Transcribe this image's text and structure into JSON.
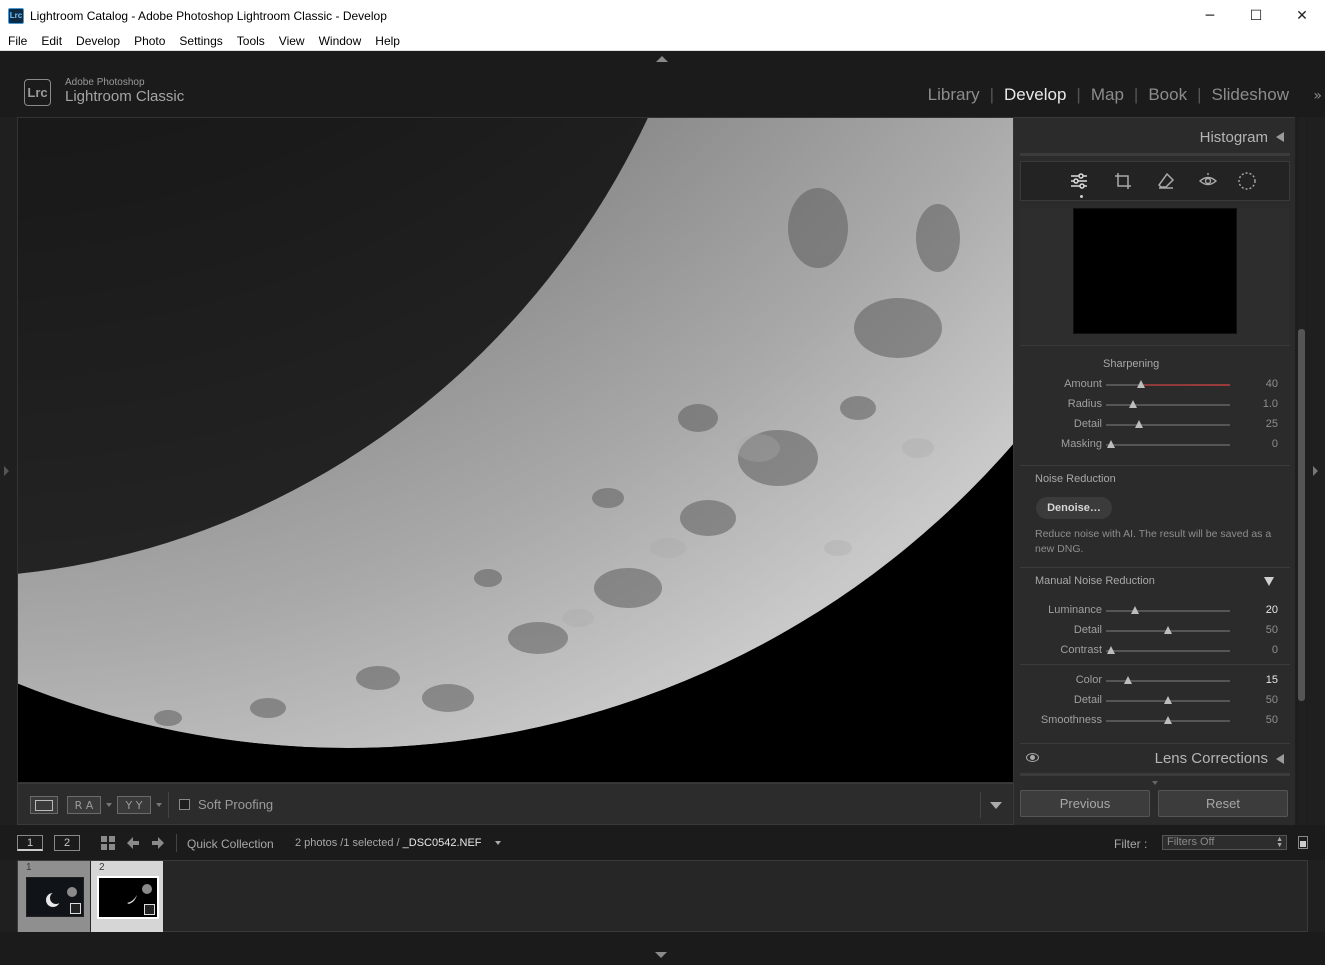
{
  "window": {
    "app_icon": "Lrc",
    "title": "Lightroom Catalog - Adobe Photoshop Lightroom Classic - Develop",
    "buttons": {
      "minimize": "─",
      "maximize": "☐",
      "close": "✕"
    }
  },
  "menu": [
    "File",
    "Edit",
    "Develop",
    "Photo",
    "Settings",
    "Tools",
    "View",
    "Window",
    "Help"
  ],
  "identity": {
    "logo": "Lrc",
    "top_line": "Adobe Photoshop",
    "main_line": "Lightroom Classic"
  },
  "modules": [
    "Library",
    "Develop",
    "Map",
    "Book",
    "Slideshow"
  ],
  "active_module": "Develop",
  "toolbar": {
    "ra_label": "R A",
    "yy_label": "Y Y",
    "soft_proofing": "Soft Proofing",
    "soft_proofing_checked": false
  },
  "right_panel": {
    "histogram": "Histogram",
    "tools": [
      "develop-sliders-icon",
      "crop-icon",
      "eraser-icon",
      "redeye-icon",
      "masking-icon"
    ],
    "sharpening": {
      "title": "Sharpening",
      "sliders": [
        {
          "label": "Amount",
          "value": "40",
          "fraction": 0.28
        },
        {
          "label": "Radius",
          "value": "1.0",
          "fraction": 0.22
        },
        {
          "label": "Detail",
          "value": "25",
          "fraction": 0.27
        },
        {
          "label": "Masking",
          "value": "0",
          "fraction": 0.04
        }
      ]
    },
    "noise_reduction": {
      "title": "Noise Reduction",
      "denoise_button": "Denoise…",
      "description": "Reduce noise with AI. The result will be saved as a new DNG.",
      "manual_title": "Manual Noise Reduction",
      "luminance_sliders": [
        {
          "label": "Luminance",
          "value": "20",
          "fraction": 0.23
        },
        {
          "label": "Detail",
          "value": "50",
          "fraction": 0.5
        },
        {
          "label": "Contrast",
          "value": "0",
          "fraction": 0.04
        }
      ],
      "color_sliders": [
        {
          "label": "Color",
          "value": "15",
          "fraction": 0.18
        },
        {
          "label": "Detail",
          "value": "50",
          "fraction": 0.5
        },
        {
          "label": "Smoothness",
          "value": "50",
          "fraction": 0.5
        }
      ]
    },
    "lens_corrections": "Lens Corrections",
    "previous_button": "Previous",
    "reset_button": "Reset"
  },
  "filmstrip_header": {
    "screen1": "1",
    "screen2": "2",
    "source": "Quick Collection",
    "info_prefix": "2 photos /1 selected /",
    "filename": "_DSC0542.NEF",
    "filter_label": "Filter :",
    "filter_value": "Filters Off"
  },
  "filmstrip": [
    {
      "number": "1",
      "selected": false
    },
    {
      "number": "2",
      "selected": true
    }
  ]
}
